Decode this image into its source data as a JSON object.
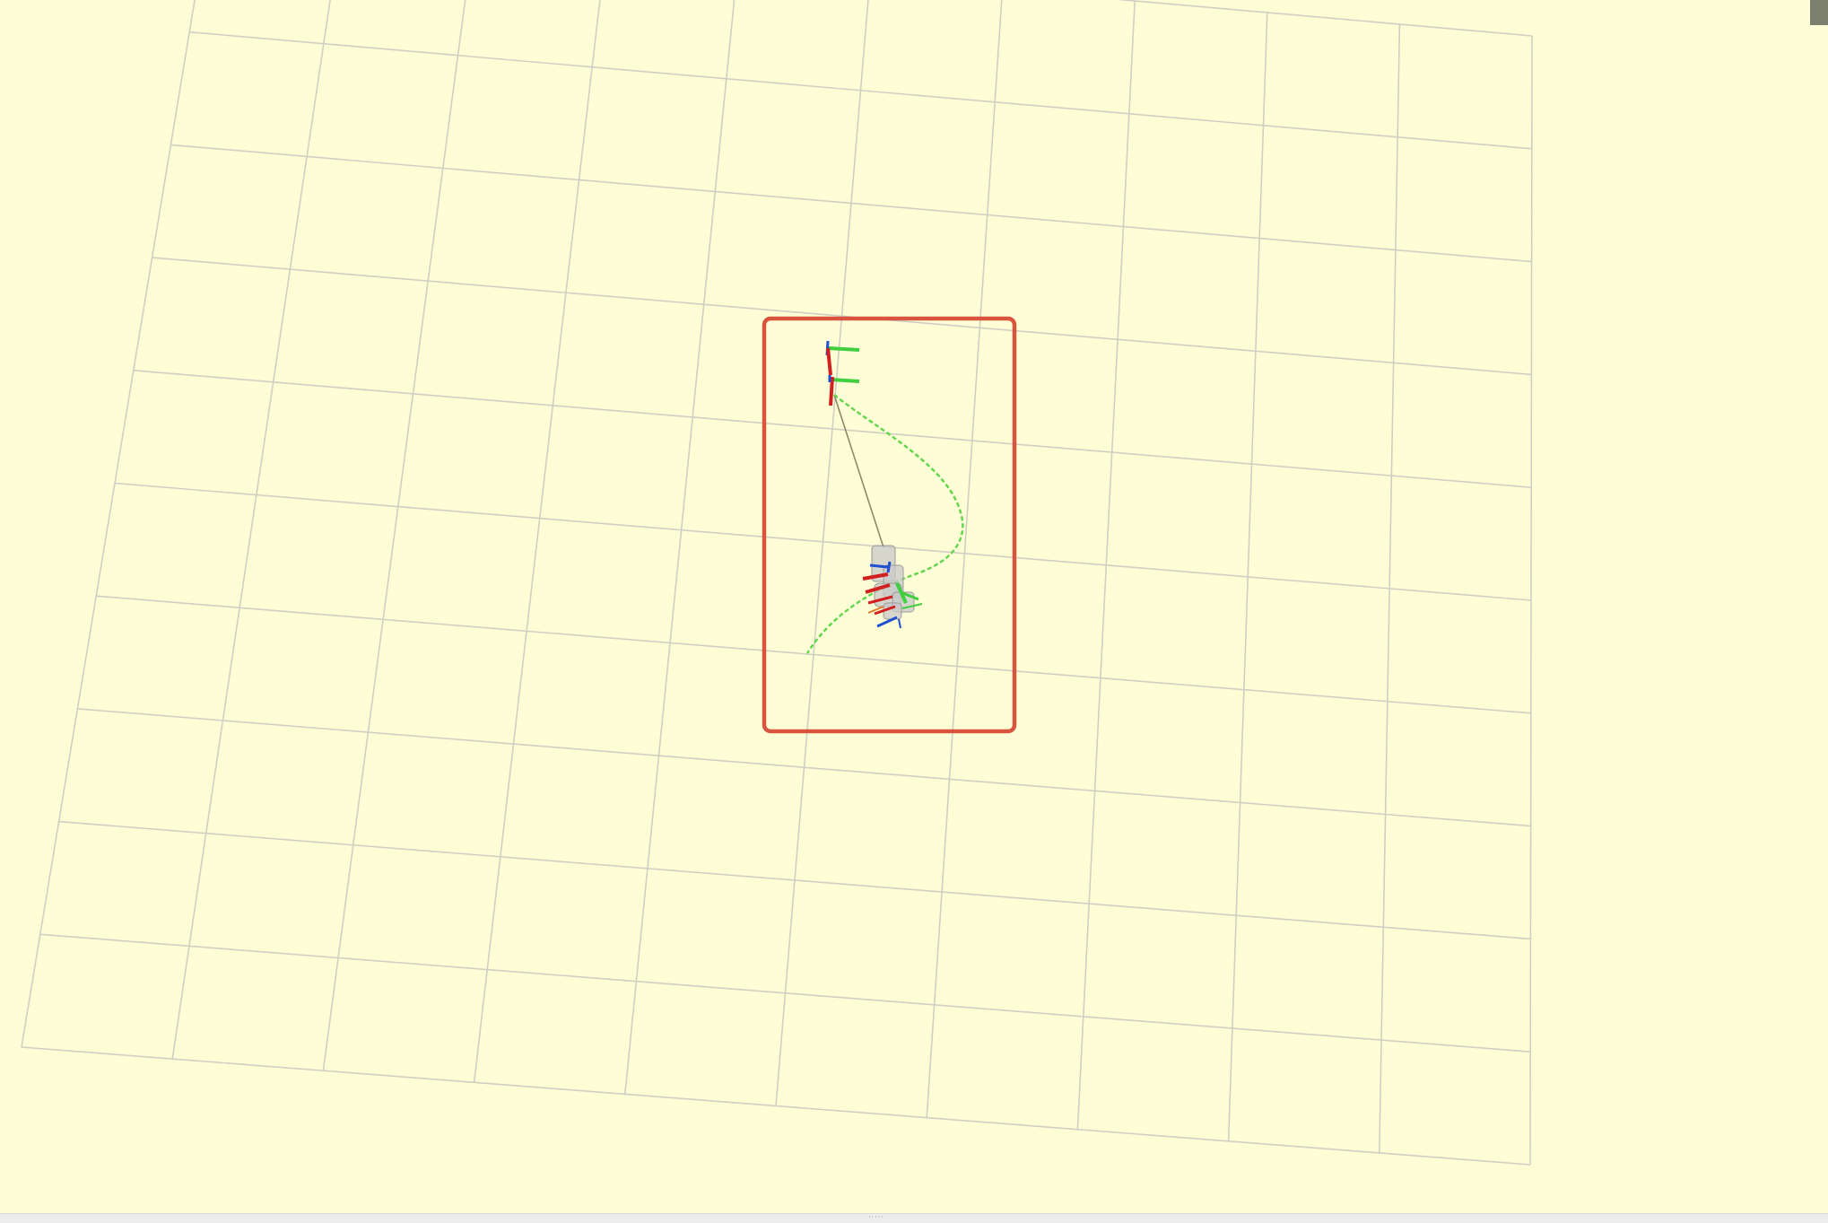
{
  "scene": {
    "background_color": "#fefed6",
    "grid_color": "#cfcfc4",
    "highlight_color": "#d9543f",
    "path_color": "#61d44b",
    "link_line_color": "#8a8a6a",
    "robot_color": "#c8c8c8",
    "axis_colors": {
      "x": "#d21f1f",
      "y": "#3fcf3f",
      "z": "#1f4fd2"
    }
  },
  "icons": {
    "corner_widget": "panel-toggle-icon",
    "splitter": "splitter-grip-icon"
  },
  "splitter": {
    "label": "·····"
  }
}
